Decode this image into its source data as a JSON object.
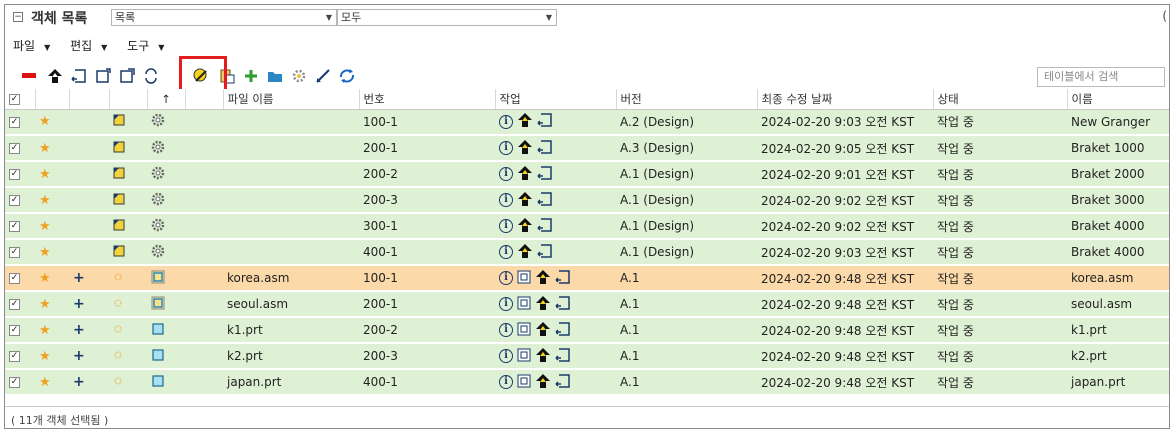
{
  "header": {
    "title": "객체 목록",
    "view_select": "목록",
    "filter_select": "모두",
    "trailing": "("
  },
  "menu": {
    "file": "파일",
    "edit": "편집",
    "tools": "도구"
  },
  "toolbar": {
    "search_placeholder": "테이블에서 검색"
  },
  "table": {
    "columns": {
      "sort": "↑",
      "filename": "파일 이름",
      "number": "번호",
      "actions": "작업",
      "version": "버전",
      "modified": "최종 수정 날짜",
      "state": "상태",
      "name": "이름"
    },
    "rows": [
      {
        "filename": "",
        "number": "100-1",
        "version": "A.2 (Design)",
        "modified": "2024-02-20 9:03 오전 KST",
        "state": "작업 중",
        "name": "New Granger"
      },
      {
        "filename": "",
        "number": "200-1",
        "version": "A.3 (Design)",
        "modified": "2024-02-20 9:05 오전 KST",
        "state": "작업 중",
        "name": "Braket 1000"
      },
      {
        "filename": "",
        "number": "200-2",
        "version": "A.1 (Design)",
        "modified": "2024-02-20 9:01 오전 KST",
        "state": "작업 중",
        "name": "Braket 2000"
      },
      {
        "filename": "",
        "number": "200-3",
        "version": "A.1 (Design)",
        "modified": "2024-02-20 9:02 오전 KST",
        "state": "작업 중",
        "name": "Braket 3000"
      },
      {
        "filename": "",
        "number": "300-1",
        "version": "A.1 (Design)",
        "modified": "2024-02-20 9:02 오전 KST",
        "state": "작업 중",
        "name": "Braket 4000"
      },
      {
        "filename": "",
        "number": "400-1",
        "version": "A.1 (Design)",
        "modified": "2024-02-20 9:03 오전 KST",
        "state": "작업 중",
        "name": "Braket 4000"
      },
      {
        "filename": "korea.asm",
        "number": "100-1",
        "version": "A.1",
        "modified": "2024-02-20 9:48 오전 KST",
        "state": "작업 중",
        "name": "korea.asm"
      },
      {
        "filename": "seoul.asm",
        "number": "200-1",
        "version": "A.1",
        "modified": "2024-02-20 9:48 오전 KST",
        "state": "작업 중",
        "name": "seoul.asm"
      },
      {
        "filename": "k1.prt",
        "number": "200-2",
        "version": "A.1",
        "modified": "2024-02-20 9:48 오전 KST",
        "state": "작업 중",
        "name": "k1.prt"
      },
      {
        "filename": "k2.prt",
        "number": "200-3",
        "version": "A.1",
        "modified": "2024-02-20 9:48 오전 KST",
        "state": "작업 중",
        "name": "k2.prt"
      },
      {
        "filename": "japan.prt",
        "number": "400-1",
        "version": "A.1",
        "modified": "2024-02-20 9:48 오전 KST",
        "state": "작업 중",
        "name": "japan.prt"
      }
    ]
  },
  "status": {
    "text": "( 11개 객체 선택됨 )"
  },
  "colors": {
    "row_bg": "#dff1d5",
    "selected_row_bg": "#fcd9a8",
    "highlight_border": "#e21d1d"
  }
}
